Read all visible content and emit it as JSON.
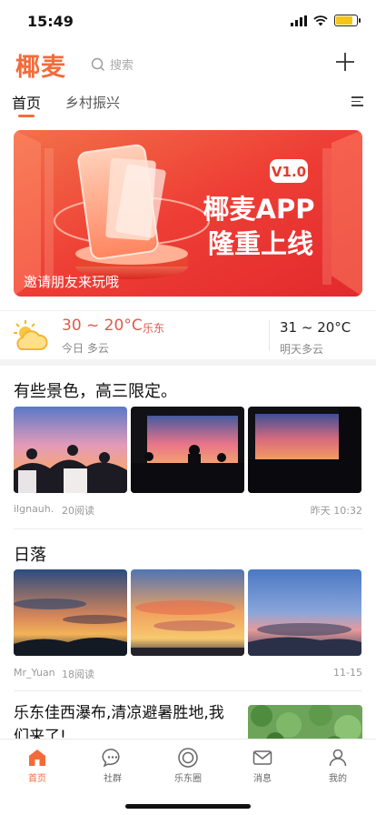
{
  "status_bar": {
    "time": "15:49",
    "battery_level": 0.8
  },
  "header": {
    "logo": "椰麦",
    "search_placeholder": "搜索",
    "add_icon": "plus-icon"
  },
  "tabs": [
    {
      "label": "首页",
      "active": true
    },
    {
      "label": "乡村振兴",
      "active": false
    }
  ],
  "banner": {
    "headline_line1": "椰麦APP",
    "headline_line2": "隆重上线",
    "version": "V1.0",
    "caption": "邀请朋友来玩哦"
  },
  "weather": {
    "today_temp": "30 ~ 20°C",
    "city": "乐东",
    "today_desc": "今日 多云",
    "tomorrow_temp": "31 ~ 20°C",
    "tomorrow_desc": "明天多云"
  },
  "articles": [
    {
      "title": "有些景色，高三限定。",
      "author": "ilgnauh.",
      "reads": "20阅读",
      "time": "昨天 10:32"
    },
    {
      "title": "日落",
      "author": "Mr_Yuan",
      "reads": "18阅读",
      "time": "11-15"
    },
    {
      "title": "乐东佳西瀑布,清凉避暑胜地,我们来了!"
    }
  ],
  "bottom_nav": [
    {
      "label": "首页",
      "icon": "home-icon",
      "active": true
    },
    {
      "label": "社群",
      "icon": "chat-bubble-icon",
      "active": false
    },
    {
      "label": "乐东圈",
      "icon": "circle-icon",
      "active": false
    },
    {
      "label": "消息",
      "icon": "mail-icon",
      "active": false
    },
    {
      "label": "我的",
      "icon": "user-icon",
      "active": false
    }
  ],
  "colors": {
    "accent": "#f36b3b",
    "weather_accent": "#e05a4a"
  }
}
